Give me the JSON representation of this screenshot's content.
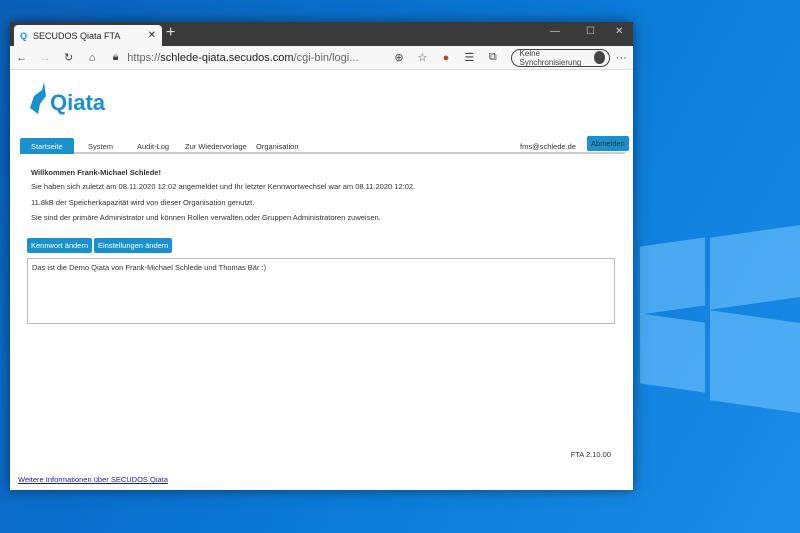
{
  "browser": {
    "tab_title": "SECUDOS Qiata FTA",
    "url_prefix": "https://",
    "url_host": "schlede-qiata.secudos.com",
    "url_path": "/cgi-bin/logi...",
    "sync_label": "Keine Synchronisierung"
  },
  "app": {
    "logo": "Qiata",
    "nav": [
      "Startseite",
      "System",
      "Audit-Log",
      "Zur Wiedervorlage",
      "Organisation"
    ],
    "user_email": "fms@schlede.de",
    "logout_label": "Abmelden"
  },
  "main": {
    "welcome": "Willkommen Frank-Michael Schlede!",
    "last_login": "Sie haben sich zuletzt am 08.11.2020 12:02 angemeldet und Ihr letzter Kennwortwechsel war am 08.11.2020 12:02.",
    "storage": "11.8kB der Speicherkapazität wird von dieser Organisation genutzt.",
    "admin_info": "Sie sind der primäre Administrator und können Rollen verwalten oder Gruppen Administratoren zuweisen.",
    "change_password": "Kennwort ändern",
    "change_settings": "Einstellungen ändern",
    "message": "Das ist die Demo Qiata von Frank-Michael Schlede und Thomas Bär :)",
    "version": "FTA 2.10.00",
    "more_info": "Weitere Informationen über SECUDOS Qiata"
  }
}
